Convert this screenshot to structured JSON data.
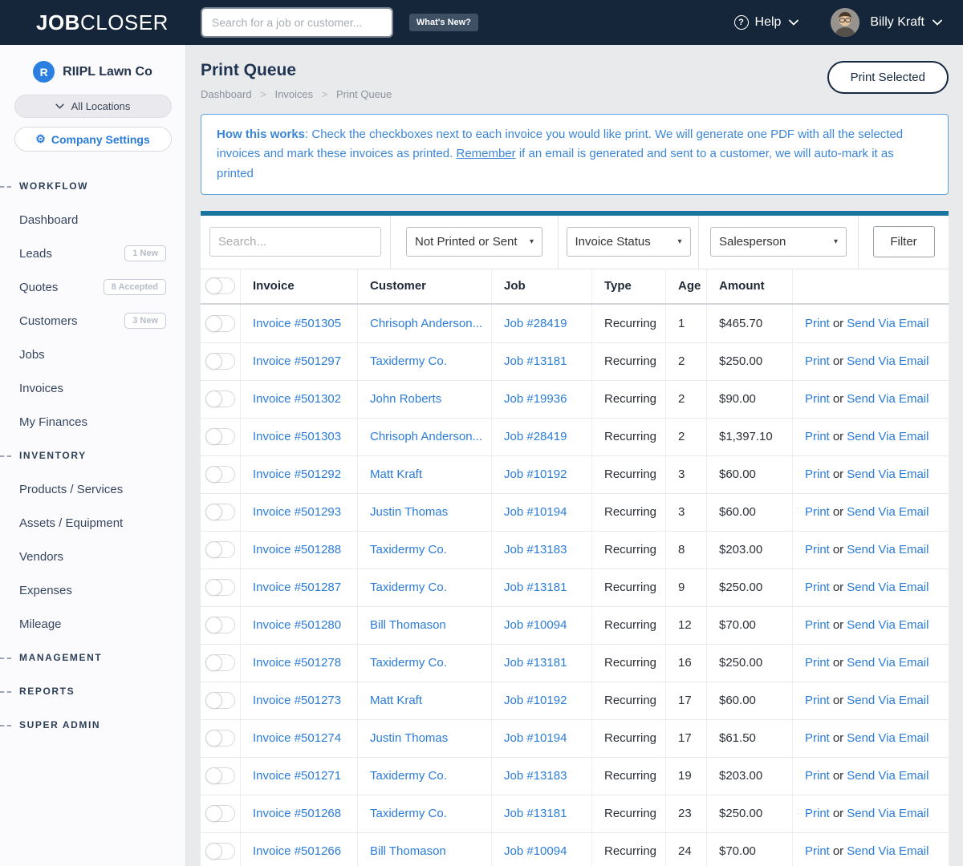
{
  "icons": {
    "question": "?",
    "gear": "⚙",
    "caret_down": "▾"
  },
  "colors": {
    "topbar_navy": "#15263a",
    "accent_teal": "#19759c",
    "link_blue": "#2b7cd9",
    "info_blue": "#3c86d8",
    "badge_gray": "#b6bcc6",
    "company_badge_blue": "#2a7fe0"
  },
  "topbar": {
    "logo_bold": "JOB",
    "logo_light": "CLOSER",
    "search_placeholder": "Search for a job or customer...",
    "whats_new_label": "What's New?",
    "help_label": "Help",
    "user_name": "Billy Kraft"
  },
  "sidebar": {
    "company": {
      "initial": "R",
      "name": "RIIPL Lawn Co"
    },
    "locations_label": "All Locations",
    "settings_label": "Company Settings",
    "sections": [
      {
        "label": "WORKFLOW",
        "items": [
          {
            "label": "Dashboard"
          },
          {
            "label": "Leads",
            "badge": "1 New"
          },
          {
            "label": "Quotes",
            "badge": "8 Accepted"
          },
          {
            "label": "Customers",
            "badge": "3 New"
          },
          {
            "label": "Jobs"
          },
          {
            "label": "Invoices"
          },
          {
            "label": "My Finances"
          }
        ]
      },
      {
        "label": "INVENTORY",
        "items": [
          {
            "label": "Products / Services"
          },
          {
            "label": "Assets / Equipment"
          },
          {
            "label": "Vendors"
          },
          {
            "label": "Expenses"
          },
          {
            "label": "Mileage"
          }
        ]
      },
      {
        "label": "MANAGEMENT",
        "items": []
      },
      {
        "label": "REPORTS",
        "items": []
      },
      {
        "label": "SUPER ADMIN",
        "items": []
      }
    ]
  },
  "main": {
    "title": "Print Queue",
    "breadcrumb": [
      "Dashboard",
      "Invoices",
      "Print Queue"
    ],
    "breadcrumb_separator": ">",
    "print_selected_label": "Print Selected",
    "info": {
      "lead": "How this works",
      "body_1": ": Check the checkboxes next to each invoice you would like print. We will generate one PDF with all the selected invoices and mark these invoices as printed. ",
      "remember": "Remember",
      "body_2": " if an email is generated and sent to a customer, we will auto-mark it as printed"
    }
  },
  "filters": {
    "search_placeholder": "Search...",
    "print_status_value": "Not Printed or Sent",
    "invoice_status_value": "Invoice Status",
    "salesperson_value": "Salesperson",
    "filter_button_label": "Filter"
  },
  "table": {
    "headers": {
      "invoice": "Invoice",
      "customer": "Customer",
      "job": "Job",
      "type": "Type",
      "age": "Age",
      "amount": "Amount"
    },
    "action_print": "Print",
    "action_or": "or",
    "action_email": "Send Via Email",
    "rows": [
      {
        "invoice": "Invoice #501305",
        "customer": "Chrisoph Anderson...",
        "job": "Job #28419",
        "type": "Recurring",
        "age": "1",
        "amount": "$465.70"
      },
      {
        "invoice": "Invoice #501297",
        "customer": "Taxidermy Co.",
        "job": "Job #13181",
        "type": "Recurring",
        "age": "2",
        "amount": "$250.00"
      },
      {
        "invoice": "Invoice #501302",
        "customer": "John Roberts",
        "job": "Job #19936",
        "type": "Recurring",
        "age": "2",
        "amount": "$90.00"
      },
      {
        "invoice": "Invoice #501303",
        "customer": "Chrisoph Anderson...",
        "job": "Job #28419",
        "type": "Recurring",
        "age": "2",
        "amount": "$1,397.10"
      },
      {
        "invoice": "Invoice #501292",
        "customer": "Matt Kraft",
        "job": "Job #10192",
        "type": "Recurring",
        "age": "3",
        "amount": "$60.00"
      },
      {
        "invoice": "Invoice #501293",
        "customer": "Justin Thomas",
        "job": "Job #10194",
        "type": "Recurring",
        "age": "3",
        "amount": "$60.00"
      },
      {
        "invoice": "Invoice #501288",
        "customer": "Taxidermy Co.",
        "job": "Job #13183",
        "type": "Recurring",
        "age": "8",
        "amount": "$203.00"
      },
      {
        "invoice": "Invoice #501287",
        "customer": "Taxidermy Co.",
        "job": "Job #13181",
        "type": "Recurring",
        "age": "9",
        "amount": "$250.00"
      },
      {
        "invoice": "Invoice #501280",
        "customer": "Bill Thomason",
        "job": "Job #10094",
        "type": "Recurring",
        "age": "12",
        "amount": "$70.00"
      },
      {
        "invoice": "Invoice #501278",
        "customer": "Taxidermy Co.",
        "job": "Job #13181",
        "type": "Recurring",
        "age": "16",
        "amount": "$250.00"
      },
      {
        "invoice": "Invoice #501273",
        "customer": "Matt Kraft",
        "job": "Job #10192",
        "type": "Recurring",
        "age": "17",
        "amount": "$60.00"
      },
      {
        "invoice": "Invoice #501274",
        "customer": "Justin Thomas",
        "job": "Job #10194",
        "type": "Recurring",
        "age": "17",
        "amount": "$61.50"
      },
      {
        "invoice": "Invoice #501271",
        "customer": "Taxidermy Co.",
        "job": "Job #13183",
        "type": "Recurring",
        "age": "19",
        "amount": "$203.00"
      },
      {
        "invoice": "Invoice #501268",
        "customer": "Taxidermy Co.",
        "job": "Job #13181",
        "type": "Recurring",
        "age": "23",
        "amount": "$250.00"
      },
      {
        "invoice": "Invoice #501266",
        "customer": "Bill Thomason",
        "job": "Job #10094",
        "type": "Recurring",
        "age": "24",
        "amount": "$70.00"
      }
    ]
  }
}
